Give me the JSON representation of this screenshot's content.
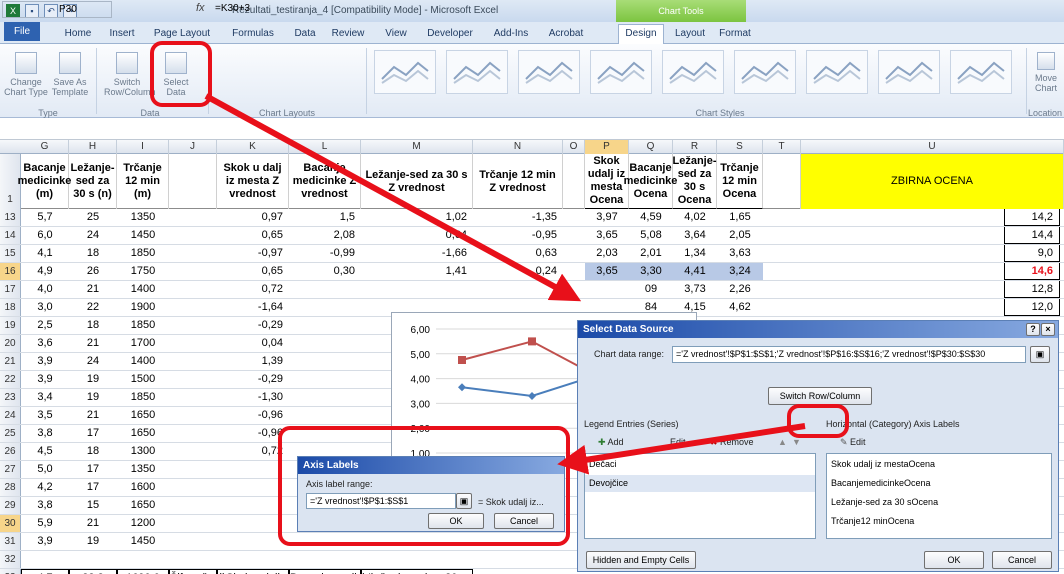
{
  "titlebar": {
    "title": "Rezultati_testiranja_4  [Compatibility Mode]  -  Microsoft Excel",
    "chart_tools": "Chart Tools"
  },
  "tabs": [
    "File",
    "Home",
    "Insert",
    "Page Layout",
    "Formulas",
    "Data",
    "Review",
    "View",
    "Developer",
    "Add-Ins",
    "Acrobat",
    "Design",
    "Layout",
    "Format"
  ],
  "ribbon": {
    "change_chart_type": "Change\nChart Type",
    "save_as_template": "Save As\nTemplate",
    "switch_row_column": "Switch\nRow/Column",
    "select_data": "Select\nData",
    "group_type": "Type",
    "group_data": "Data",
    "group_chart_layouts": "Chart Layouts",
    "group_chart_styles": "Chart Styles",
    "move_chart": "Move\nChart",
    "group_location": "Location"
  },
  "formula_bar": {
    "name_box": "P30",
    "fx": "fx",
    "formula": "=K30+3"
  },
  "columns": [
    "G",
    "H",
    "I",
    "J",
    "K",
    "L",
    "M",
    "N",
    "O",
    "P",
    "Q",
    "R",
    "S",
    "T",
    "U"
  ],
  "headers": {
    "G": "Bacanje medicinke (m)",
    "H": "Ležanje-sed za 30 s (n)",
    "I": "Trčanje 12 min (m)",
    "K": "Skok u dalj iz mesta  Z vrednost",
    "L": "Bacanje medicinke Z vrednost",
    "M": "Ležanje-sed za 30 s Z vrednost",
    "N": "Trčanje 12 min Z vrednost",
    "P": "Skok udalj iz mesta Ocena",
    "Q": "Bacanje medicinke Ocena",
    "R": "Ležanje-sed za 30 s Ocena",
    "S": "Trčanje 12 min Ocena",
    "U": "ZBIRNA OCENA"
  },
  "rows": [
    {
      "n": "13",
      "G": "5,7",
      "H": "25",
      "I": "1350",
      "K": "0,97",
      "L": "1,5",
      "M": "1,02",
      "N": "-1,35",
      "P": "3,97",
      "Q": "4,59",
      "R": "4,02",
      "S": "1,65",
      "U": "14,2"
    },
    {
      "n": "14",
      "G": "6,0",
      "H": "24",
      "I": "1450",
      "K": "0,65",
      "L": "2,08",
      "M": "0,64",
      "N": "-0,95",
      "P": "3,65",
      "Q": "5,08",
      "R": "3,64",
      "S": "2,05",
      "U": "14,4"
    },
    {
      "n": "15",
      "G": "4,1",
      "H": "18",
      "I": "1850",
      "K": "-0,97",
      "L": "-0,99",
      "M": "-1,66",
      "N": "0,63",
      "P": "2,03",
      "Q": "2,01",
      "R": "1,34",
      "S": "3,63",
      "U": "9,0"
    },
    {
      "n": "16",
      "G": "4,9",
      "H": "26",
      "I": "1750",
      "K": "0,65",
      "L": "0,30",
      "M": "1,41",
      "N": "0,24",
      "P": "3,65",
      "Q": "3,30",
      "R": "4,41",
      "S": "3,24",
      "U": "14,6"
    },
    {
      "n": "17",
      "G": "4,0",
      "H": "21",
      "I": "1400",
      "K": "0,72",
      "L": "",
      "M": "",
      "N": "",
      "P": "",
      "Q": "09",
      "R": "3,73",
      "S": "2,26",
      "U": "12,8"
    },
    {
      "n": "18",
      "G": "3,0",
      "H": "22",
      "I": "1900",
      "K": "-1,64",
      "L": "",
      "M": "",
      "N": "",
      "P": "",
      "Q": "84",
      "R": "4,15",
      "S": "4,62",
      "U": "12,0"
    },
    {
      "n": "19",
      "G": "2,5",
      "H": "18",
      "I": "1850",
      "K": "-0,29",
      "L": "",
      "M": "",
      "N": "",
      "P": "",
      "Q": "",
      "R": "",
      "S": "",
      "U": ""
    },
    {
      "n": "20",
      "G": "3,6",
      "H": "21",
      "I": "1700",
      "K": "0,04",
      "L": "",
      "M": "",
      "N": "",
      "P": "",
      "Q": "",
      "R": "",
      "S": "",
      "U": ""
    },
    {
      "n": "21",
      "G": "3,9",
      "H": "24",
      "I": "1400",
      "K": "1,39",
      "L": "",
      "M": "",
      "N": "",
      "P": "",
      "Q": "",
      "R": "",
      "S": "",
      "U": ""
    },
    {
      "n": "22",
      "G": "3,9",
      "H": "19",
      "I": "1500",
      "K": "-0,29",
      "L": "",
      "M": "",
      "N": "",
      "P": "",
      "Q": "",
      "R": "",
      "S": "",
      "U": ""
    },
    {
      "n": "23",
      "G": "3,4",
      "H": "19",
      "I": "1850",
      "K": "-1,30",
      "L": "",
      "M": "",
      "N": "",
      "P": "",
      "Q": "",
      "R": "",
      "S": "",
      "U": ""
    },
    {
      "n": "24",
      "G": "3,5",
      "H": "21",
      "I": "1650",
      "K": "-0,96",
      "L": "",
      "M": "",
      "N": "",
      "P": "",
      "Q": "",
      "R": "",
      "S": "",
      "U": ""
    },
    {
      "n": "25",
      "G": "3,8",
      "H": "17",
      "I": "1650",
      "K": "-0,96",
      "L": "",
      "M": "",
      "N": "",
      "P": "",
      "Q": "",
      "R": "",
      "S": "",
      "U": ""
    },
    {
      "n": "26",
      "G": "4,5",
      "H": "18",
      "I": "1300",
      "K": "0,72",
      "L": "",
      "M": "",
      "N": "",
      "P": "",
      "Q": "",
      "R": "",
      "S": "",
      "U": ""
    },
    {
      "n": "27",
      "G": "5,0",
      "H": "17",
      "I": "1350",
      "K": "",
      "L": "",
      "M": "",
      "N": "",
      "P": "",
      "Q": "",
      "R": "",
      "S": "",
      "U": ""
    },
    {
      "n": "28",
      "G": "4,2",
      "H": "17",
      "I": "1600",
      "K": "",
      "L": "",
      "M": "",
      "N": "",
      "P": "",
      "Q": "",
      "R": "",
      "S": "",
      "U": ""
    },
    {
      "n": "29",
      "G": "3,8",
      "H": "15",
      "I": "1650",
      "K": "",
      "L": "",
      "M": "",
      "N": "",
      "P": "",
      "Q": "",
      "R": "",
      "S": "",
      "U": ""
    },
    {
      "n": "30",
      "G": "5,9",
      "H": "21",
      "I": "1200",
      "K": "",
      "L": "",
      "M": "",
      "N": "",
      "P": "",
      "Q": "",
      "R": "",
      "S": "",
      "U": ""
    },
    {
      "n": "31",
      "G": "3,9",
      "H": "19",
      "I": "1450",
      "K": "",
      "L": "",
      "M": "",
      "N": "",
      "P": "",
      "Q": "",
      "R": "",
      "S": "",
      "U": ""
    },
    {
      "n": "32",
      "G": "",
      "H": "",
      "I": "",
      "K": "",
      "L": "",
      "M": "",
      "N": "",
      "P": "",
      "Q": "",
      "R": "",
      "S": "",
      "U": ""
    },
    {
      "n": "33",
      "G": "4,7",
      "H": "22,3",
      "I": "1690,0",
      "J": "Šifra učenika",
      "K": "Skok u dalj",
      "L": "Bacanje medicinke",
      "M": "Ležanje sed za 30 s",
      "N": "",
      "P": "",
      "Q": "",
      "R": "",
      "S": "",
      "U": ""
    }
  ],
  "chart_data": {
    "type": "line",
    "y_ticks": [
      "1,00",
      "2,00",
      "3,00",
      "4,00",
      "5,00",
      "6,00"
    ],
    "ylim": [
      1,
      6
    ],
    "series": [
      {
        "name": "Dečaci",
        "color": "#4a7ebb",
        "values": [
          3.65,
          3.3,
          4.2
        ]
      },
      {
        "name": "Devojčice",
        "color": "#c0504d",
        "values": [
          4.75,
          5.5,
          4.0
        ]
      }
    ]
  },
  "select_data": {
    "title": "Select Data Source",
    "help": "?",
    "close": "×",
    "chart_range_label": "Chart data range:",
    "chart_range_value": "='Z vrednost'!$P$1:$S$1;'Z vrednost'!$P$16:$S$16;'Z vrednost'!$P$30:$S$30",
    "switch": "Switch Row/Column",
    "legend_label": "Legend Entries (Series)",
    "add": "Add",
    "edit": "Edit",
    "remove": "Remove",
    "axis_label": "Horizontal (Category) Axis Labels",
    "axis_edit": "Edit",
    "series": [
      "Dečaci",
      "Devojčice"
    ],
    "categories": [
      "Skok udalj iz mestaOcena",
      "BacanjemedicinkeOcena",
      "Ležanje-sed za 30 sOcena",
      "Trčanje12 minOcena"
    ],
    "hidden": "Hidden and Empty Cells",
    "ok": "OK",
    "cancel": "Cancel"
  },
  "axis_dialog": {
    "title": "Axis Labels",
    "range_label": "Axis label range:",
    "range_value": "='Z vrednost'!$P$1:$S$1",
    "preview": "= Skok udalj iz...",
    "ok": "OK",
    "cancel": "Cancel"
  }
}
